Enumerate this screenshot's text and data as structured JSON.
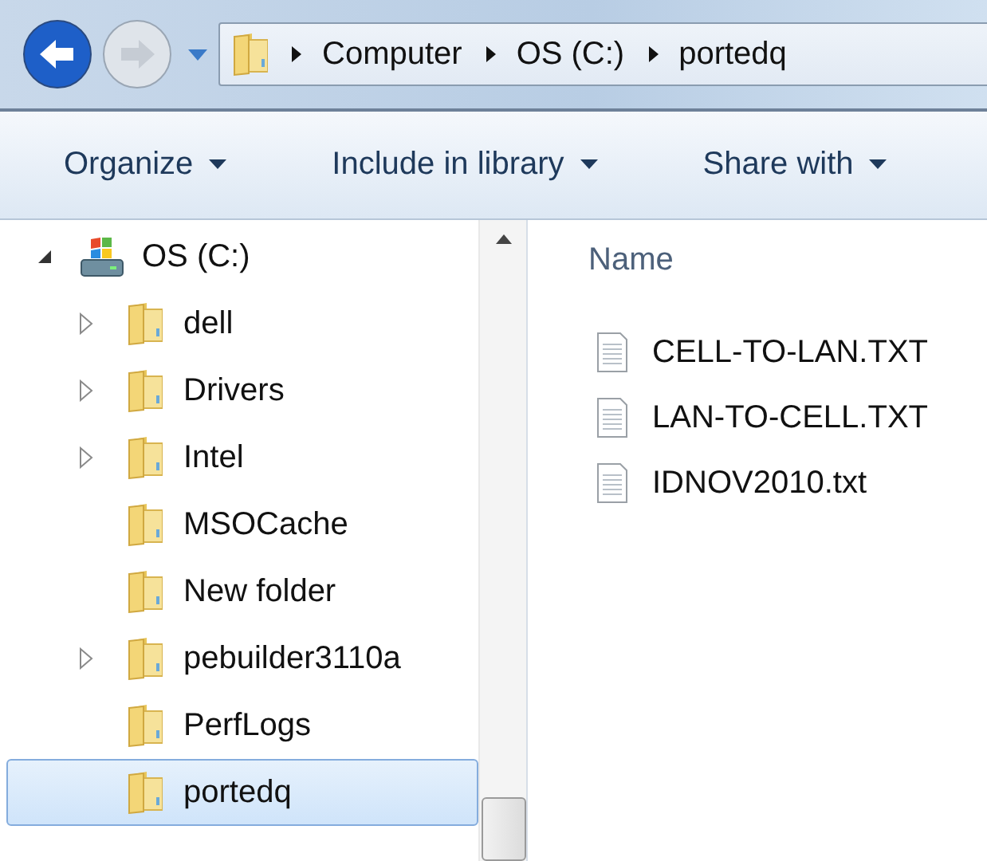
{
  "navigation": {
    "back_enabled": true,
    "forward_enabled": false
  },
  "address_bar": {
    "breadcrumbs": [
      "Computer",
      "OS (C:)",
      "portedq"
    ]
  },
  "toolbar": {
    "buttons": [
      "Organize",
      "Include in library",
      "Share with"
    ]
  },
  "sidebar": {
    "tree": [
      {
        "name": "OS (C:)",
        "kind": "drive",
        "expanded": true,
        "selected": false,
        "children": [
          {
            "name": "dell",
            "kind": "folder",
            "expandable": true,
            "selected": false
          },
          {
            "name": "Drivers",
            "kind": "folder",
            "expandable": true,
            "selected": false
          },
          {
            "name": "Intel",
            "kind": "folder",
            "expandable": true,
            "selected": false
          },
          {
            "name": "MSOCache",
            "kind": "folder",
            "expandable": false,
            "selected": false
          },
          {
            "name": "New folder",
            "kind": "folder",
            "expandable": false,
            "selected": false
          },
          {
            "name": "pebuilder3110a",
            "kind": "folder",
            "expandable": true,
            "selected": false
          },
          {
            "name": "PerfLogs",
            "kind": "folder",
            "expandable": false,
            "selected": false
          },
          {
            "name": "portedq",
            "kind": "folder",
            "expandable": false,
            "selected": true
          }
        ]
      }
    ]
  },
  "file_list": {
    "column": "Name",
    "files": [
      "CELL-TO-LAN.TXT",
      "LAN-TO-CELL.TXT",
      "IDNOV2010.txt"
    ]
  }
}
